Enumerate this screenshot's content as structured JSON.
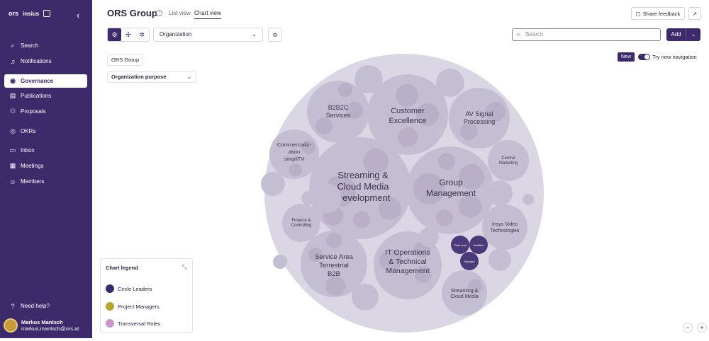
{
  "sidebar": {
    "logos": [
      "ors",
      "insius",
      "logo-mark"
    ],
    "items": [
      {
        "label": "Search",
        "icon": "search-icon"
      },
      {
        "label": "Notifications",
        "icon": "bell-icon"
      },
      {
        "label": "Governance",
        "icon": "governance-icon",
        "active": true
      },
      {
        "label": "Publications",
        "icon": "publications-icon"
      },
      {
        "label": "Proposals",
        "icon": "proposals-icon"
      },
      {
        "label": "OKRs",
        "icon": "target-icon"
      },
      {
        "label": "Inbox",
        "icon": "inbox-icon"
      },
      {
        "label": "Meetings",
        "icon": "calendar-icon"
      },
      {
        "label": "Members",
        "icon": "members-icon"
      }
    ],
    "help": "Need help?",
    "user": {
      "name": "Markus Mantsch",
      "email": "markus.mantsch@ors.at"
    }
  },
  "header": {
    "title": "ORS Group",
    "tabs": [
      "List view",
      "Chart view"
    ],
    "share": "Share feedback"
  },
  "toolbar": {
    "select_value": "Organization",
    "search_placeholder": "Search",
    "add_label": "Add"
  },
  "breadcrumb": "ORS Group",
  "purpose_label": "Organization purpose",
  "new_nav": {
    "badge": "New",
    "label": "Try new navigation"
  },
  "legend": {
    "title": "Chart legend",
    "items": [
      {
        "label": "Circle Leaders",
        "color": "#3c2a6b"
      },
      {
        "label": "Project Managers",
        "color": "#b3a62a"
      },
      {
        "label": "Transversal Roles",
        "color": "#c99ac9"
      }
    ]
  },
  "circles": {
    "root": "ORS Group",
    "big": [
      {
        "label1": "Streaming &",
        "label2": "Cloud Media",
        "label3": "Development"
      },
      {
        "label1": "Group",
        "label2": "Management"
      },
      {
        "label1": "Customer",
        "label2": "Excellence"
      },
      {
        "label1": "IT Operations",
        "label2": "& Technical",
        "label3": "Management"
      },
      {
        "label1": "Service Area",
        "label2": "Terrestrial",
        "label3": "B2B"
      },
      {
        "label1": "B2B2C",
        "label2": "Services"
      },
      {
        "label1": "AV Signal",
        "label2": "Processing"
      },
      {
        "label1": "Commercializ-",
        "label2": "ation",
        "label3": "simpliTV"
      },
      {
        "label1": "Insys Video",
        "label2": "Technologies"
      },
      {
        "label1": "Streaming &",
        "label2": "Cloud Media"
      },
      {
        "label1": "Central",
        "label2": "Marketing"
      },
      {
        "label1": "Finance &",
        "label2": "Controlling"
      }
    ],
    "roles": [
      "Circle Lead",
      "Facilitator",
      "Secretary"
    ]
  },
  "zoom": {
    "out": "−",
    "in": "+"
  }
}
